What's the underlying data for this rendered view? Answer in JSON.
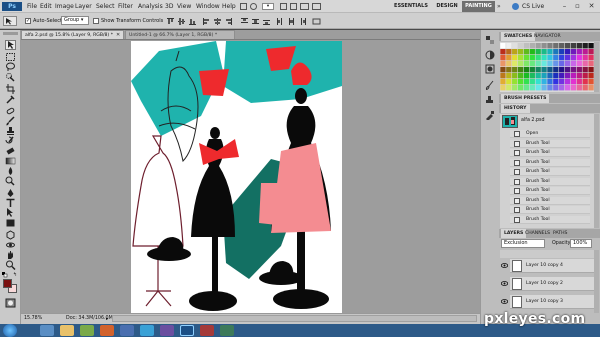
{
  "menubar": {
    "logo": "Ps",
    "items": [
      "File",
      "Edit",
      "Image",
      "Layer",
      "Select",
      "Filter",
      "Analysis",
      "3D",
      "View",
      "Window",
      "Help"
    ],
    "workspaces": [
      "ESSENTIALS",
      "DESIGN",
      "PAINTING"
    ],
    "active_workspace": "PAINTING",
    "cs_live": "CS Live"
  },
  "options": {
    "auto_select_label": "Auto-Select:",
    "auto_select_value": "Group",
    "show_transform_label": "Show Transform Controls"
  },
  "documents": [
    {
      "title": "alfa 2.psd @ 15.8% (Layer 9, RGB/8) *",
      "active": true
    },
    {
      "title": "Untitled-1 @ 66.7% (Layer 1, RGB/8) *",
      "active": false
    }
  ],
  "status": {
    "zoom": "15.78%",
    "doc": "Doc: 34.3M/106.0M"
  },
  "panels": {
    "swatch_tabs": [
      "SWATCHES",
      "NAVIGATOR"
    ],
    "brush_presets": "BRUSH PRESETS",
    "history_tab": "HISTORY",
    "history_file": "alfa 2.psd",
    "history_items": [
      "Open",
      "Brush Tool",
      "Brush Tool",
      "Brush Tool",
      "Brush Tool",
      "Brush Tool",
      "Brush Tool",
      "Brush Tool",
      "Brush Tool",
      "Brush Tool"
    ],
    "layer_tabs": [
      "LAYERS",
      "CHANNELS",
      "PATHS"
    ],
    "blend_mode": "Exclusion",
    "opacity_label": "Opacity:",
    "opacity_value": "100%",
    "layers": [
      "Layer 10 copy 4",
      "Layer 10 copy 2",
      "Layer 10 copy 3"
    ]
  },
  "watermark": "pxleyes.com",
  "colors": {
    "teal": "#1fb3ad",
    "dark_teal": "#137063",
    "red": "#ee2a2d",
    "pink": "#f48c91",
    "black": "#0a0a0a",
    "active_workspace_bg": "#6f6f6f",
    "taskbar": "#2d5a88"
  }
}
